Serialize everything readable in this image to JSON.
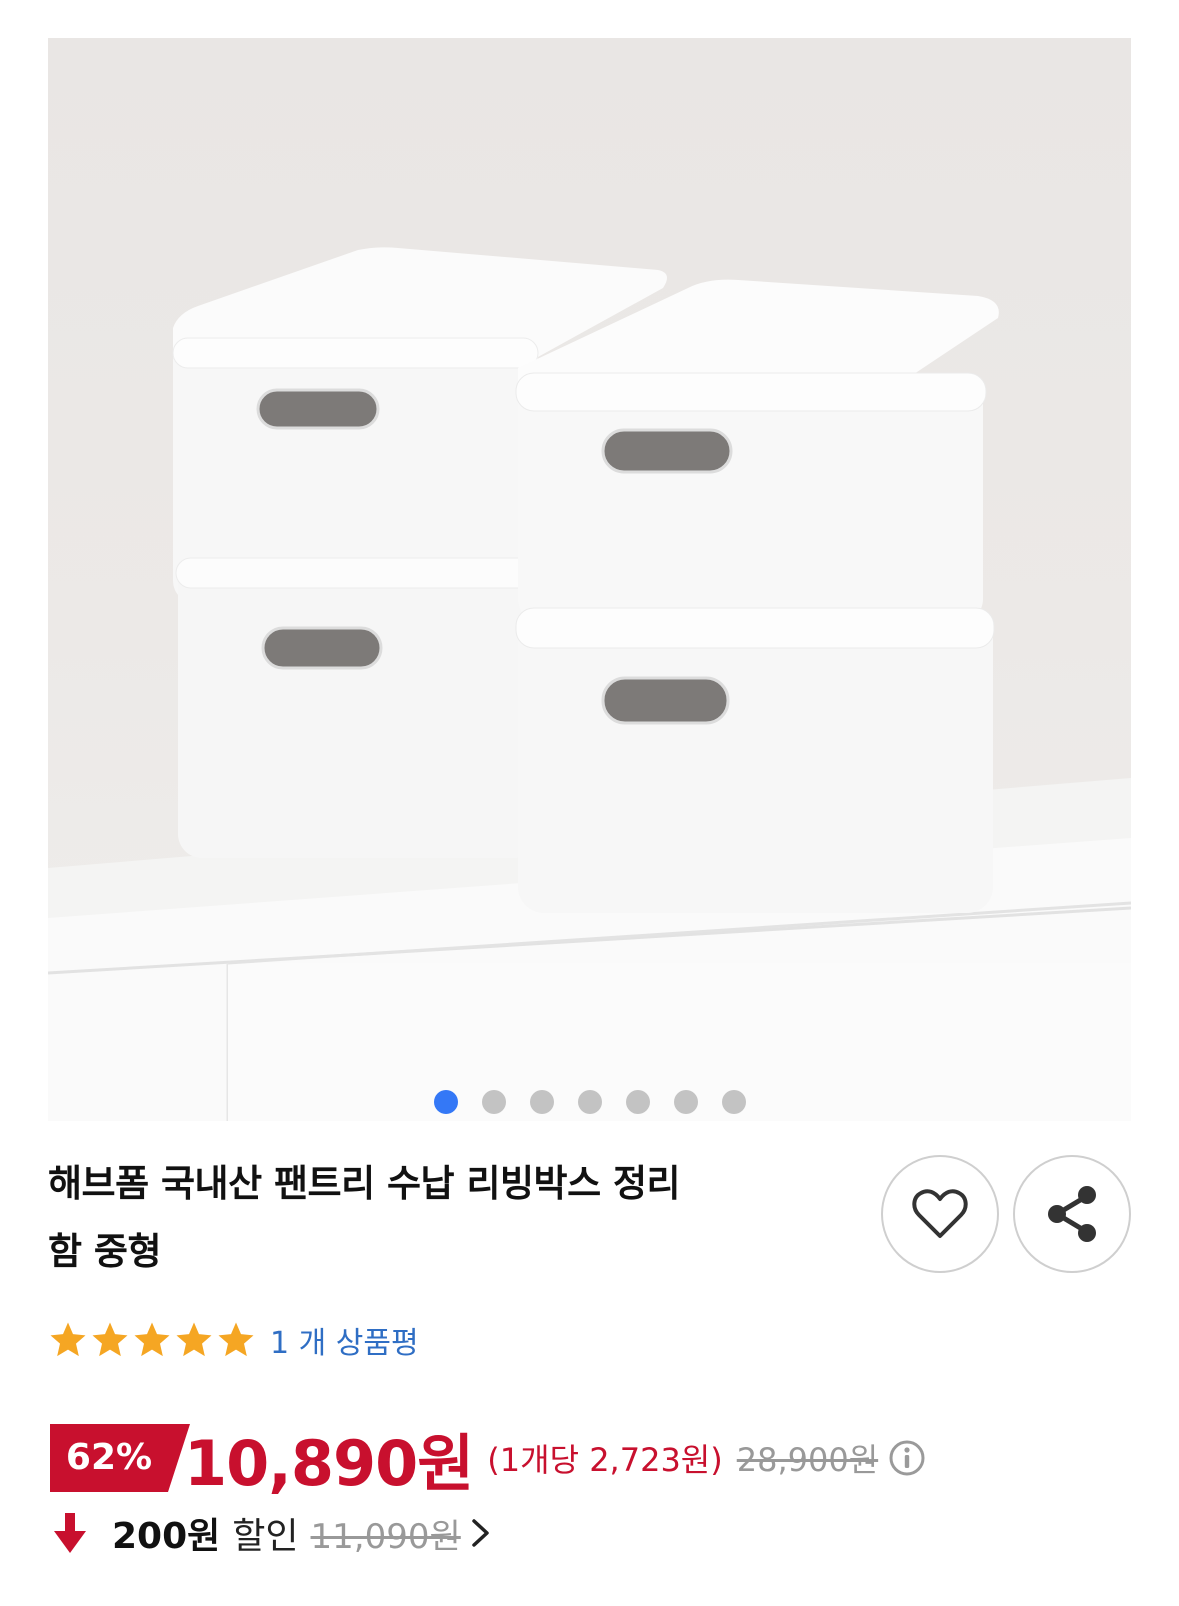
{
  "gallery": {
    "image_alt": "white storage boxes",
    "total_images": 7,
    "active_index": 0
  },
  "product": {
    "title_line1": "해브폼 국내산 팬트리 수납 리빙박스 정리",
    "title_line2": "함 중형"
  },
  "actions": {
    "wish_icon": "heart-icon",
    "share_icon": "share-icon"
  },
  "rating": {
    "stars": 5,
    "review_text": "1 개 상품평"
  },
  "price": {
    "discount_rate": "62%",
    "sale_price": "10,890원",
    "unit_price": "(1개당 2,723원)",
    "original_price": "28,900원"
  },
  "coupon": {
    "amount": "200원",
    "label": "할인",
    "original": "11,090원"
  },
  "colors": {
    "accent_red": "#c8102e",
    "link_blue": "#2f6ec4",
    "dot_active": "#3478f6",
    "star": "#f5a623"
  }
}
